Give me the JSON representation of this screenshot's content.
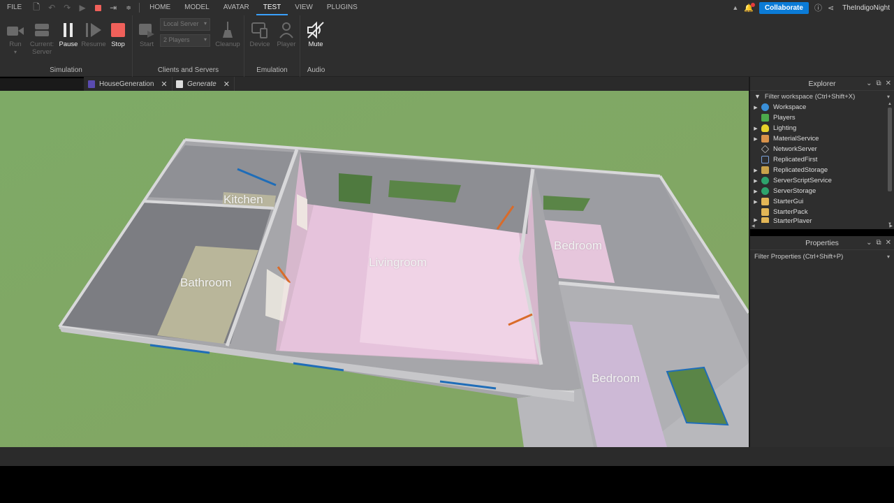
{
  "menubar": {
    "file": "FILE",
    "tabs": [
      {
        "label": "HOME"
      },
      {
        "label": "MODEL"
      },
      {
        "label": "AVATAR"
      },
      {
        "label": "TEST"
      },
      {
        "label": "VIEW"
      },
      {
        "label": "PLUGINS"
      }
    ],
    "active_tab": "TEST",
    "collaborate": "Collaborate",
    "username": "TheIndigoNight"
  },
  "ribbon": {
    "simulation": {
      "label": "Simulation",
      "run": "Run",
      "current_server": "Current: Server",
      "pause": "Pause",
      "resume": "Resume",
      "stop": "Stop"
    },
    "clients": {
      "label": "Clients and Servers",
      "start": "Start",
      "server_select": "Local Server",
      "players_select": "2 Players",
      "cleanup": "Cleanup"
    },
    "emulation": {
      "label": "Emulation",
      "device": "Device",
      "player": "Player"
    },
    "audio": {
      "label": "Audio",
      "mute": "Mute"
    }
  },
  "doc_tabs": [
    {
      "label": "HouseGeneration"
    },
    {
      "label": "Generate"
    }
  ],
  "viewport": {
    "rooms": {
      "kitchen": "Kitchen",
      "bathroom": "Bathroom",
      "livingroom": "Livingroom",
      "bedroom1": "Bedroom",
      "bedroom2": "Bedroom"
    }
  },
  "explorer": {
    "title": "Explorer",
    "filter": "Filter workspace (Ctrl+Shift+X)",
    "items": [
      {
        "label": "Workspace",
        "icon": "globe-icon",
        "expandable": true
      },
      {
        "label": "Players",
        "icon": "players-icon",
        "expandable": false
      },
      {
        "label": "Lighting",
        "icon": "bulb-icon",
        "expandable": true
      },
      {
        "label": "MaterialService",
        "icon": "material-icon",
        "expandable": true
      },
      {
        "label": "NetworkServer",
        "icon": "network-icon",
        "expandable": false
      },
      {
        "label": "ReplicatedFirst",
        "icon": "replicated-first-icon",
        "expandable": false
      },
      {
        "label": "ReplicatedStorage",
        "icon": "storage-icon",
        "expandable": true
      },
      {
        "label": "ServerScriptService",
        "icon": "script-service-icon",
        "expandable": true
      },
      {
        "label": "ServerStorage",
        "icon": "server-storage-icon",
        "expandable": true
      },
      {
        "label": "StarterGui",
        "icon": "folder-icon",
        "expandable": true
      },
      {
        "label": "StarterPack",
        "icon": "folder-icon",
        "expandable": false
      },
      {
        "label": "StarterPlayer",
        "icon": "folder-icon",
        "expandable": true
      }
    ]
  },
  "properties": {
    "title": "Properties",
    "filter": "Filter Properties (Ctrl+Shift+P)"
  },
  "colors": {
    "accent": "#0b7bd6",
    "stop": "#f0605a",
    "ground": "#7ea463",
    "floor_pink": "#e8c3db",
    "wall": "#a9a9ad"
  }
}
